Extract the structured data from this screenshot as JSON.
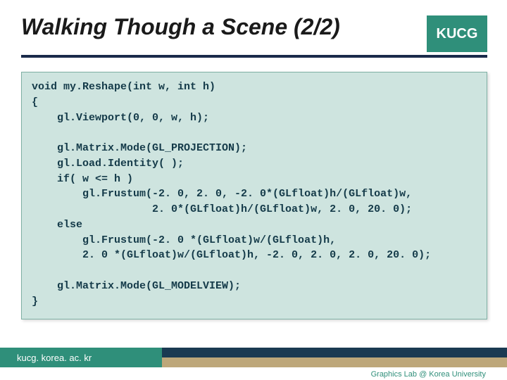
{
  "header": {
    "title": "Walking Though a Scene (2/2)",
    "badge": "KUCG"
  },
  "code": "void my.Reshape(int w, int h)\n{\n    gl.Viewport(0, 0, w, h);\n\n    gl.Matrix.Mode(GL_PROJECTION);\n    gl.Load.Identity( );\n    if( w <= h )\n        gl.Frustum(-2. 0, 2. 0, -2. 0*(GLfloat)h/(GLfloat)w,\n                   2. 0*(GLfloat)h/(GLfloat)w, 2. 0, 20. 0);\n    else\n        gl.Frustum(-2. 0 *(GLfloat)w/(GLfloat)h,\n        2. 0 *(GLfloat)w/(GLfloat)h, -2. 0, 2. 0, 2. 0, 20. 0);\n\n    gl.Matrix.Mode(GL_MODELVIEW);\n}",
  "footer": {
    "left": "kucg. korea. ac. kr",
    "right": "Graphics Lab @ Korea University"
  }
}
